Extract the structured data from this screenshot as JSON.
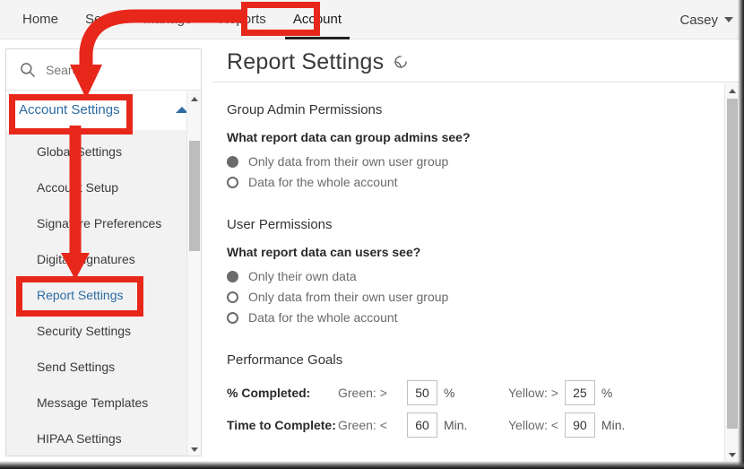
{
  "topnav": {
    "items": [
      {
        "label": "Home",
        "active": false
      },
      {
        "label": "Send",
        "active": false
      },
      {
        "label": "Manage",
        "active": false
      },
      {
        "label": "Reports",
        "active": false
      },
      {
        "label": "Account",
        "active": true
      }
    ],
    "user": "Casey"
  },
  "sidebar": {
    "search_placeholder": "Search",
    "search_value": "",
    "group_label": "Account Settings",
    "items": [
      {
        "label": "Global Settings",
        "selected": false
      },
      {
        "label": "Account Setup",
        "selected": false
      },
      {
        "label": "Signature Preferences",
        "selected": false
      },
      {
        "label": "Digital Signatures",
        "selected": false
      },
      {
        "label": "Report Settings",
        "selected": true
      },
      {
        "label": "Security Settings",
        "selected": false
      },
      {
        "label": "Send Settings",
        "selected": false
      },
      {
        "label": "Message Templates",
        "selected": false
      },
      {
        "label": "HIPAA Settings",
        "selected": false
      }
    ]
  },
  "main": {
    "title": "Report Settings",
    "sections": {
      "group_admin": {
        "heading": "Group Admin Permissions",
        "question": "What report data can group admins see?",
        "options": [
          {
            "label": "Only data from their own user group",
            "checked": true
          },
          {
            "label": "Data for the whole account",
            "checked": false
          }
        ]
      },
      "user_permissions": {
        "heading": "User Permissions",
        "question": "What report data can users see?",
        "options": [
          {
            "label": "Only their own data",
            "checked": true
          },
          {
            "label": "Only data from their own user group",
            "checked": false
          },
          {
            "label": "Data for the whole account",
            "checked": false
          }
        ]
      },
      "performance_goals": {
        "heading": "Performance Goals",
        "rows": [
          {
            "name": "% Completed:",
            "green_op": "Green: >",
            "green_value": "50",
            "green_unit": "%",
            "yellow_op": "Yellow: >",
            "yellow_value": "25",
            "yellow_unit": "%"
          },
          {
            "name": "Time to Complete:",
            "green_op": "Green: <",
            "green_value": "60",
            "green_unit": "Min.",
            "yellow_op": "Yellow: <",
            "yellow_value": "90",
            "yellow_unit": "Min."
          }
        ]
      }
    }
  },
  "colors": {
    "annotation_red": "#e8271b",
    "link_blue": "#2d6ca2",
    "nav_background": "#f4f4f4",
    "submenu_background": "#f2f2f2",
    "scrollbar_thumb": "#bdbdbd"
  }
}
